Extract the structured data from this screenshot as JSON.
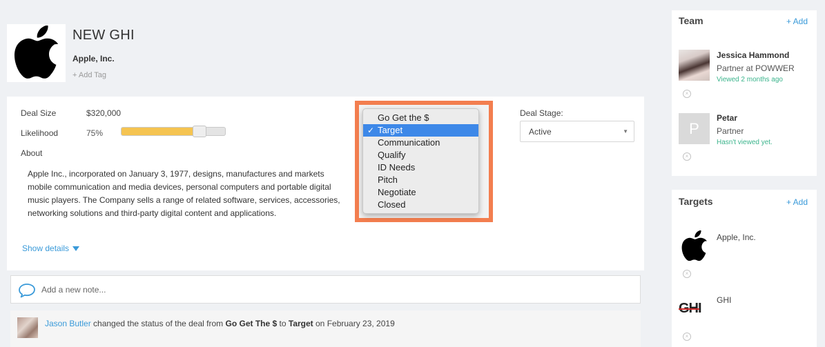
{
  "deal": {
    "title": "NEW GHI",
    "company": "Apple, Inc.",
    "add_tag": "+ Add Tag"
  },
  "details": {
    "deal_size_label": "Deal Size",
    "deal_size_value": "$320,000",
    "likelihood_label": "Likelihood",
    "likelihood_value": "75%",
    "likelihood_fraction": 0.75,
    "about_label": "About",
    "about_text": "Apple Inc., incorporated on January 3, 1977, designs, manufactures and markets mobile communication and media devices, personal computers and portable digital music players. The Company sells a range of related software, services, accessories, networking solutions and third-party digital content and applications.",
    "show_details": "Show details"
  },
  "status_dropdown": {
    "selected": "Target",
    "options": [
      "Go Get the $",
      "Target",
      "Communication",
      "Qualify",
      "ID Needs",
      "Pitch",
      "Negotiate",
      "Closed"
    ]
  },
  "deal_stage": {
    "label": "Deal Stage:",
    "value": "Active"
  },
  "note": {
    "placeholder": "Add a new note..."
  },
  "activity": {
    "user": "Jason Butler",
    "text_1": " changed the status of the deal from ",
    "from": "Go Get The $",
    "text_2": " to ",
    "to": "Target",
    "text_3": " on February 23, 2019"
  },
  "team": {
    "title": "Team",
    "add": "+ Add",
    "members": [
      {
        "name": "Jessica Hammond",
        "role": "Partner at POWWER",
        "viewed": "Viewed 2 months ago"
      },
      {
        "name": "Petar",
        "initial": "P",
        "role": "Partner",
        "viewed": "Hasn't viewed yet."
      }
    ]
  },
  "targets": {
    "title": "Targets",
    "add": "+ Add",
    "items": [
      {
        "name": "Apple, Inc."
      },
      {
        "name": "GHI",
        "logo_text": "GHI"
      }
    ]
  },
  "colors": {
    "accent": "#3a9ad9",
    "highlight": "#f37e4f",
    "slider": "#f5c451",
    "viewed": "#3bb48c"
  }
}
